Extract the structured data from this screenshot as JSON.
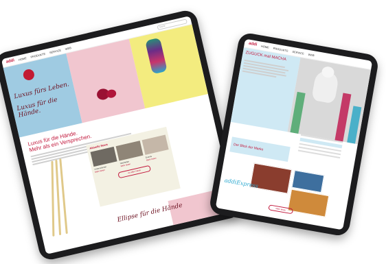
{
  "tablet_left": {
    "nav": {
      "logo": "addi",
      "items": [
        "HOME",
        "PRODUKTE",
        "SERVICE",
        "WEB"
      ],
      "search_placeholder": "Suche"
    },
    "hero": {
      "script_line1": "Luxus fürs Leben.",
      "script_line2": "Luxus für die Hände."
    },
    "headline_line1": "Luxus für die Hände.",
    "headline_line2": "Mehr als ein Versprechen.",
    "news": {
      "heading": "Aktuelle News",
      "cards": [
        {
          "caption": "Unternehmen",
          "red": "Mehr lesen"
        },
        {
          "caption": "Neuheiten",
          "red": "Mehr lesen"
        },
        {
          "caption": "Events",
          "red": "Mehr lesen"
        }
      ],
      "button": "Zu allen News"
    },
    "bottom_script": "Ellipse für die Hände"
  },
  "tablet_right": {
    "nav": {
      "logo": "addi",
      "items": [
        "HOME",
        "PRODUKTE",
        "SERVICE",
        "WEB"
      ]
    },
    "hero_title": "ZUGUCK mal MACHA",
    "section_title": "Der Blick der Marke",
    "script_small": "addiExpress",
    "button": "Mehr lesen",
    "colors": {
      "accent": "#c2183c",
      "light_blue": "#cfe9f4"
    }
  }
}
